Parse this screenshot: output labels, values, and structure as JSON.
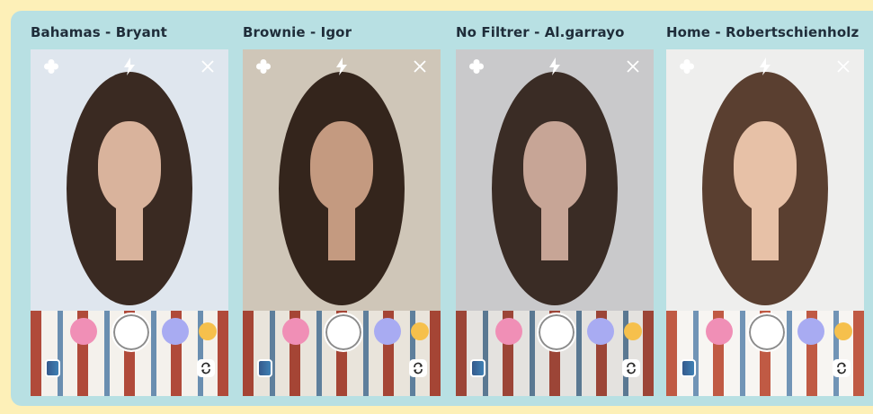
{
  "panels": [
    {
      "title": "Bahamas - Bryant",
      "bg": "#dfe6ee",
      "hair": "#3a2a22",
      "skin": "#d9b39c",
      "shirt": "#b04a3a"
    },
    {
      "title": "Brownie - Igor",
      "bg": "#cfc6b8",
      "hair": "#34251c",
      "skin": "#c49a80",
      "shirt": "#a54535"
    },
    {
      "title": "No Filtrer - Al.garrayo",
      "bg": "#c9c9cb",
      "hair": "#3a2c25",
      "skin": "#c7a596",
      "shirt": "#9c4537"
    },
    {
      "title": "Home - Robertschienholz",
      "bg": "#eeeeed",
      "hair": "#5a3f30",
      "skin": "#e7c1a7",
      "shirt": "#c05a44"
    }
  ],
  "colors": {
    "pink": "#f08fb6",
    "lavender": "#a8abf2",
    "yellow": "#f6c04c"
  },
  "icons": {
    "settings": "flower-icon",
    "flash": "flash-icon",
    "close": "close-icon",
    "gallery": "gallery-icon",
    "flip": "camera-flip-icon"
  }
}
